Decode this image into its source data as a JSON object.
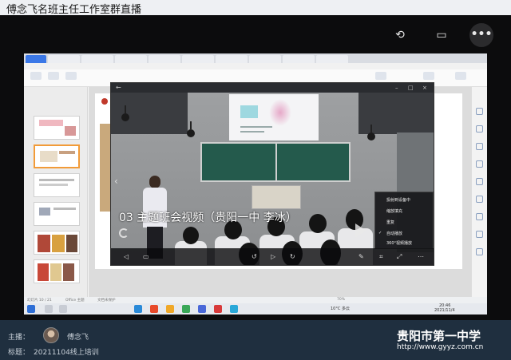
{
  "live": {
    "title": "傅念飞名班主任工作室群直播",
    "host_label": "主播：",
    "host_name": "傅念飞",
    "topic_label": "标题：",
    "topic": "20211104线上培训"
  },
  "watermark": {
    "school": "贵阳市第一中学",
    "url": "http://www.gyyz.com.cn"
  },
  "player": {
    "subtitle": "03 主题班会视频（贵阳一中 李冰）",
    "context_menu": [
      "投射到设备中",
      "缩放填充",
      "重复",
      "自动播放",
      "360°视频播放"
    ],
    "checked_index": 3
  },
  "desktop": {
    "status_left": "幻灯片 10 / 21",
    "status_office": "Office 主题",
    "status_hint": "文档未保护",
    "zoom": "70%",
    "time": "20:46",
    "date": "2021/11/4",
    "weather": "10°C 多云"
  },
  "colors": {
    "live_bg": "#0c0c0d",
    "info_bg": "#1f2f3f",
    "accent": "#3b78e7",
    "selected_slide": "#f29b38"
  }
}
